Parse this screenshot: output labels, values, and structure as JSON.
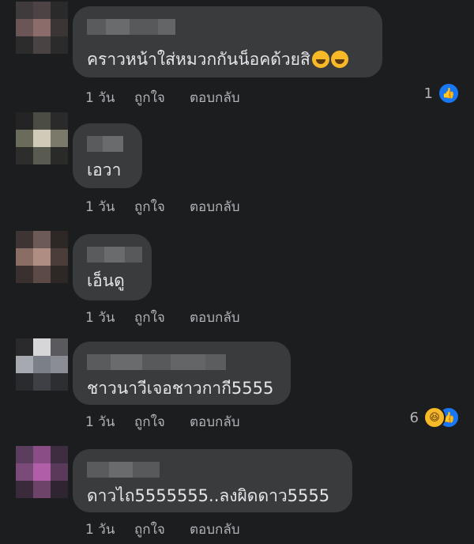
{
  "comments": [
    {
      "text": "คราวหน้าใส่หมวกกันน็อคด้วยสิ",
      "time": "1 วัน",
      "like_label": "ถูกใจ",
      "reply_label": "ตอบกลับ",
      "reaction_count": "1",
      "reactions": [
        "like-icon"
      ],
      "emojis": [
        "rolling-laughing-emoji",
        "rolling-laughing-emoji"
      ],
      "avatar_colors": [
        "#3f3b3c",
        "#4d4344",
        "#2b2a2b",
        "#6b5556",
        "#8c6c6a",
        "#3b3536",
        "#2d2c2d",
        "#4a4344",
        "#2c2b2c"
      ]
    },
    {
      "text": "เอวา",
      "time": "1 วัน",
      "like_label": "ถูกใจ",
      "reply_label": "ตอบกลับ",
      "avatar_colors": [
        "#242424",
        "#4b4c44",
        "#2a2a2a",
        "#6b6b5c",
        "#cfcbb8",
        "#7b7a6a",
        "#2d2d2b",
        "#595a50",
        "#2a2a29"
      ]
    },
    {
      "text": "เอ็นดู",
      "time": "1 วัน",
      "like_label": "ถูกใจ",
      "reply_label": "ตอบกลับ",
      "avatar_colors": [
        "#3e3433",
        "#6b5a56",
        "#2d2826",
        "#8a6e66",
        "#b08d82",
        "#4a3d3a",
        "#3a302f",
        "#5c4a46",
        "#2d2726"
      ]
    },
    {
      "text": "ชาวนาวีเจอชาวกากี5555",
      "time": "1 วัน",
      "like_label": "ถูกใจ",
      "reply_label": "ตอบกลับ",
      "reaction_count": "6",
      "reactions": [
        "haha-icon",
        "like-icon"
      ],
      "avatar_colors": [
        "#2a2a2c",
        "#d6d6d8",
        "#5a5a5e",
        "#a6a9b0",
        "#7b7f88",
        "#8a8d94",
        "#2a2b2e",
        "#3e4046",
        "#2d2e31"
      ]
    },
    {
      "text": "ดาวไถ5555555..ลงผิดดาว5555",
      "time": "1 วัน",
      "like_label": "ถูกใจ",
      "reply_label": "ตอบกลับ",
      "avatar_colors": [
        "#5b3e5e",
        "#8a4d86",
        "#3e2c40",
        "#7a4a78",
        "#b05ea6",
        "#5a3a5a",
        "#3a2a3b",
        "#6d436a",
        "#2e2530"
      ]
    }
  ]
}
